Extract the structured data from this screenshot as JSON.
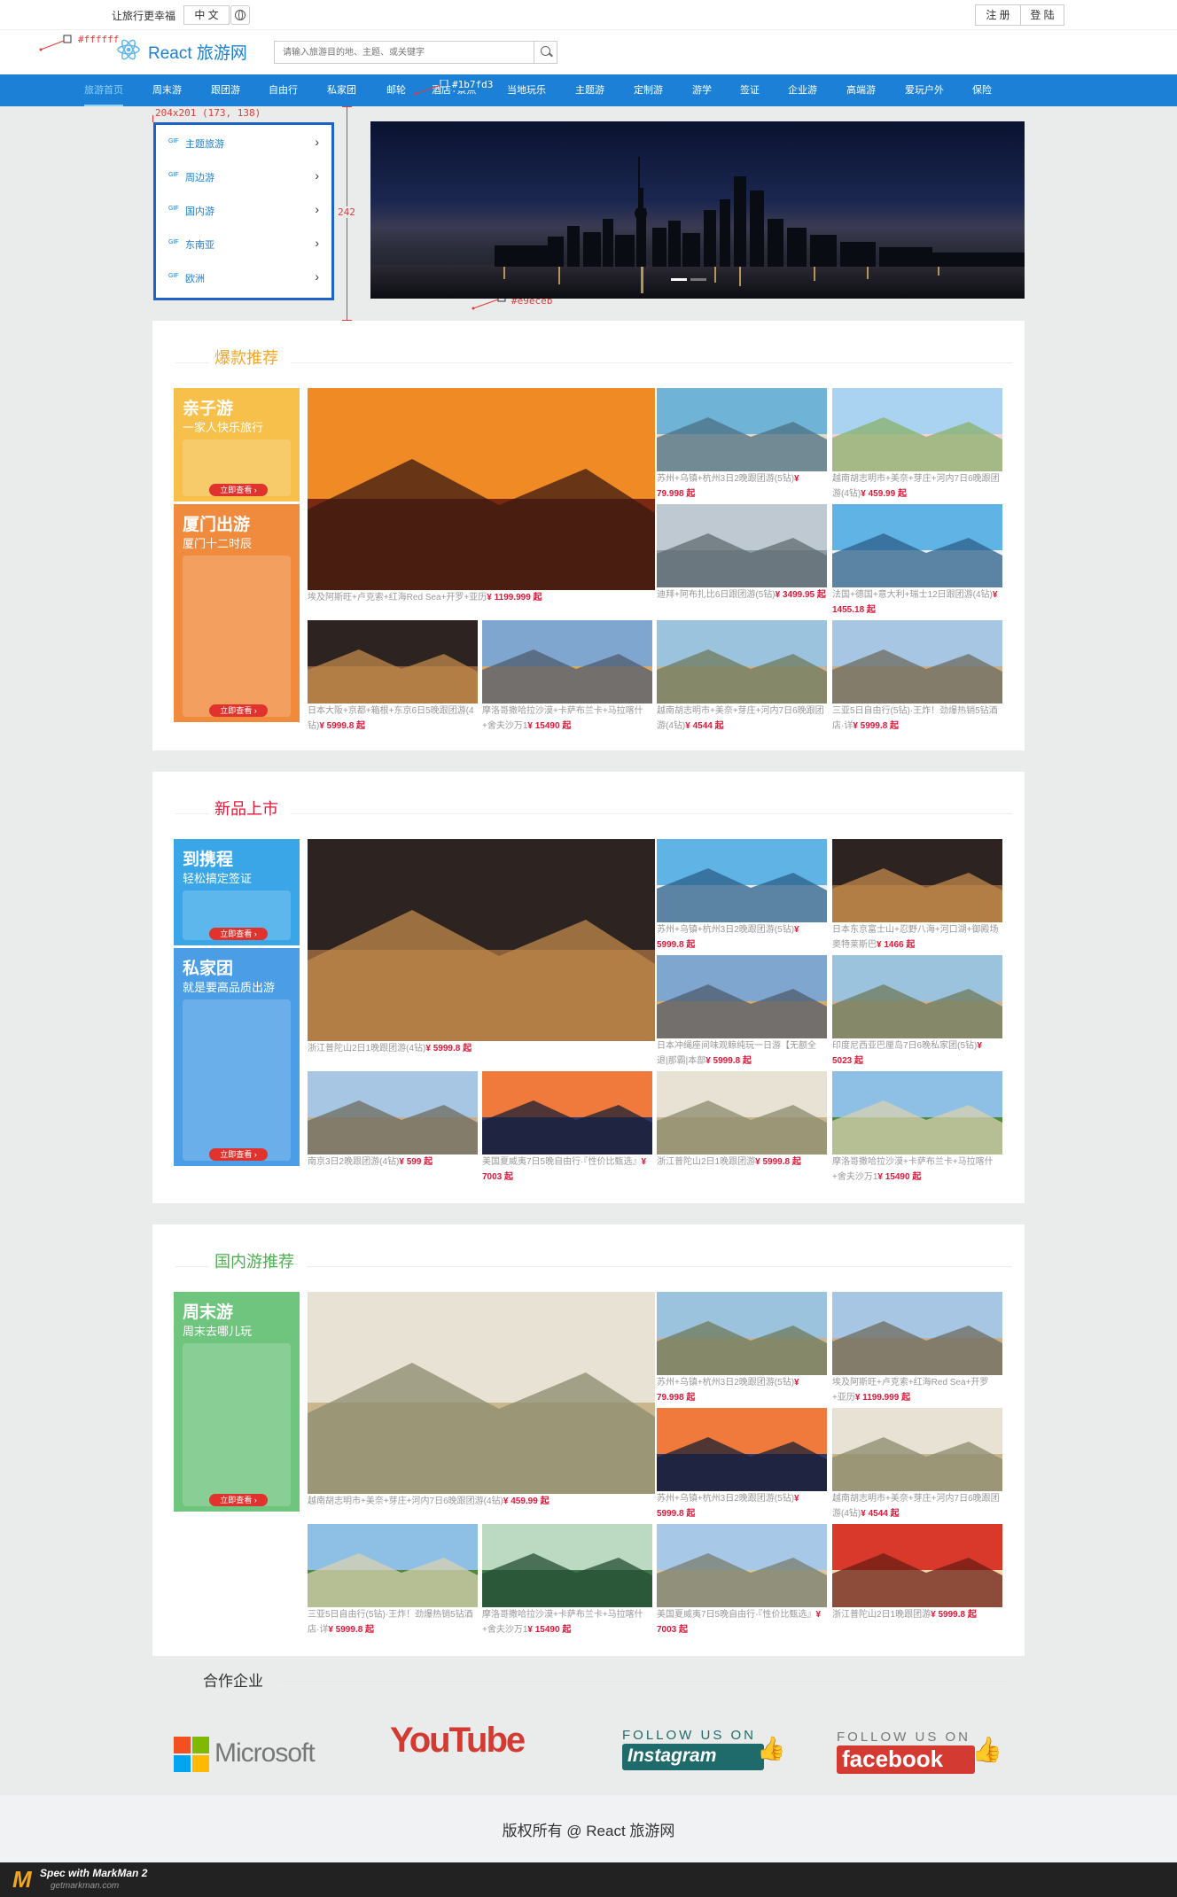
{
  "topbar": {
    "slogan": "让旅行更幸福",
    "language": "中 文",
    "register": "注 册",
    "login": "登 陆"
  },
  "header": {
    "logo_text": "React 旅游网",
    "search_placeholder": "请输入旅游目的地、主题、或关键字"
  },
  "nav": [
    "旅游首页",
    "周末游",
    "跟团游",
    "自由行",
    "私家团",
    "邮轮",
    "酒店+景点",
    "当地玩乐",
    "主题游",
    "定制游",
    "游学",
    "签证",
    "企业游",
    "高端游",
    "爱玩户外",
    "保险"
  ],
  "annotations": {
    "white": "#ffffff",
    "blue": "#1b7fd3",
    "gray": "#e9eceb",
    "size": "204x201 (173, 138)",
    "height": "242"
  },
  "side_menu": {
    "gif": "GIF",
    "items": [
      "主题旅游",
      "周边游",
      "国内游",
      "东南亚",
      "欧洲"
    ]
  },
  "sections": [
    {
      "title": "爆款推荐",
      "color": "#f5a623",
      "promo": [
        {
          "title": "亲子游",
          "sub": "一家人快乐旅行",
          "btn": "立即查看 ›"
        },
        {
          "title": "厦门出游",
          "sub": "厦门十二时辰",
          "btn": "立即查看 ›"
        }
      ],
      "big": {
        "text": "埃及阿斯旺+卢克索+红海Red Sea+开罗+亚历",
        "price": "¥ 1199.999 起"
      },
      "small": [
        {
          "text": "苏州+乌镇+杭州3日2晚跟团游(5钻)",
          "price": "¥ 79.998 起"
        },
        {
          "text": "越南胡志明市+美奈+芽庄+河内7日6晚跟团游(4钻)",
          "price": "¥ 459.99 起"
        },
        {
          "text": "迪拜+阿布扎比6日跟团游(5钻)",
          "price": "¥ 3499.95 起"
        },
        {
          "text": "法国+德国+意大利+瑞士12日跟团游(4钻)",
          "price": "¥ 1455.18 起"
        },
        {
          "text": "日本大阪+京都+箱根+东京6日5晚跟团游(4钻)",
          "price": "¥ 5999.8 起"
        },
        {
          "text": "摩洛哥撒哈拉沙漠+卡萨布兰卡+马拉喀什+舍夫沙万1",
          "price": "¥ 15490 起"
        },
        {
          "text": "越南胡志明市+美奈+芽庄+河内7日6晚跟团游(4钻)",
          "price": "¥ 4544 起"
        },
        {
          "text": "三亚5日自由行(5钻)·王炸！劲爆热销5钻酒店·详",
          "price": "¥ 5999.8 起"
        }
      ]
    },
    {
      "title": "新品上市",
      "color": "#e0183a",
      "promo": [
        {
          "title": "到携程",
          "sub": "轻松搞定签证",
          "btn": "立即查看 ›"
        },
        {
          "title": "私家团",
          "sub": "就是要高品质出游",
          "btn": "立即查看 ›"
        }
      ],
      "big": {
        "text": "浙江普陀山2日1晚跟团游(4钻)",
        "price": "¥ 5999.8 起"
      },
      "small": [
        {
          "text": "苏州+乌镇+杭州3日2晚跟团游(5钻)",
          "price": "¥ 5999.8 起"
        },
        {
          "text": "日本东京富士山+忍野八海+河口湖+御殿场奥特莱斯巴",
          "price": "¥ 1466 起"
        },
        {
          "text": "日本冲绳座间味观鲸纯玩一日游【无额全退|那霸|本部",
          "price": "¥ 5999.8 起"
        },
        {
          "text": "印度尼西亚巴厘岛7日6晚私家团(5钻)",
          "price": "¥ 5023 起"
        },
        {
          "text": "南京3日2晚跟团游(4钻)",
          "price": "¥ 599 起"
        },
        {
          "text": "美国夏威夷7日5晚自由行·『性价比甄选』",
          "price": "¥ 7003 起"
        },
        {
          "text": "浙江普陀山2日1晚跟团游",
          "price": "¥ 5999.8 起"
        },
        {
          "text": "摩洛哥撒哈拉沙漠+卡萨布兰卡+马拉喀什+舍夫沙万1",
          "price": "¥ 15490 起"
        }
      ]
    },
    {
      "title": "国内游推荐",
      "color": "#4caf50",
      "promo": [
        {
          "title": "周末游",
          "sub": "周末去哪儿玩",
          "btn": "立即查看 ›"
        }
      ],
      "big": {
        "text": "越南胡志明市+美奈+芽庄+河内7日6晚跟团游(4钻)",
        "price": "¥ 459.99 起"
      },
      "small": [
        {
          "text": "苏州+乌镇+杭州3日2晚跟团游(5钻)",
          "price": "¥ 79.998 起"
        },
        {
          "text": "埃及阿斯旺+卢克索+红海Red Sea+开罗+亚历",
          "price": "¥ 1199.999 起"
        },
        {
          "text": "苏州+乌镇+杭州3日2晚跟团游(5钻)",
          "price": "¥ 5999.8 起"
        },
        {
          "text": "越南胡志明市+美奈+芽庄+河内7日6晚跟团游(4钻)",
          "price": "¥ 4544 起"
        },
        {
          "text": "三亚5日自由行(5钻)·王炸！劲爆热销5钻酒店·详",
          "price": "¥ 5999.8 起"
        },
        {
          "text": "摩洛哥撒哈拉沙漠+卡萨布兰卡+马拉喀什+舍夫沙万1",
          "price": "¥ 15490 起"
        },
        {
          "text": "美国夏威夷7日5晚自由行·『性价比甄选』",
          "price": "¥ 7003 起"
        },
        {
          "text": "浙江普陀山2日1晚跟团游",
          "price": "¥ 5999.8 起"
        }
      ]
    }
  ],
  "partners": {
    "title": "合作企业",
    "microsoft": "Microsoft",
    "youtube": "YouTube",
    "instagram_top": "FOLLOW US ON",
    "instagram": "Instagram",
    "facebook_top": "FOLLOW US ON",
    "facebook": "facebook"
  },
  "footer": "版权所有 @ React 旅游网",
  "markman": {
    "title": "Spec with MarkMan 2",
    "url": "getmarkman.com"
  }
}
